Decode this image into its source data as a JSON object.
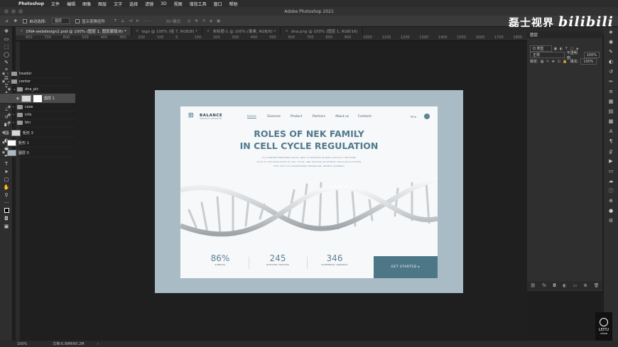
{
  "menubar": {
    "app": "Photoshop",
    "items": [
      "文件",
      "编辑",
      "图像",
      "图层",
      "文字",
      "选择",
      "滤镜",
      "3D",
      "视图",
      "增效工具",
      "窗口",
      "帮助"
    ]
  },
  "titlebar": {
    "title": "Adobe Photoshop 2021"
  },
  "options": {
    "auto_select_label": "自动选择:",
    "auto_select_value": "图层",
    "show_transform_label": "显示变换控件",
    "mode_label": "3D 模式:"
  },
  "brand": {
    "text": "磊士视界",
    "bili": "bilibili"
  },
  "tabs": [
    {
      "label": "DNA-webdesign2.psd @ 100% (图层 1, 图层蒙版/8) *"
    },
    {
      "label": "logo @ 100% (组 7, RGB/8) *"
    },
    {
      "label": "未标题-1 @ 100% (像素, RGB/8) *"
    },
    {
      "label": "dna.png @ 100% (图层 1, RGB/16)"
    }
  ],
  "ruler": {
    "ticks": [
      "800",
      "700",
      "600",
      "500",
      "400",
      "300",
      "200",
      "100",
      "0",
      "100",
      "200",
      "300",
      "400",
      "500",
      "600",
      "700",
      "800",
      "900",
      "1000",
      "1100",
      "1200",
      "1300",
      "1400",
      "1500",
      "1600",
      "1700",
      "1800"
    ]
  },
  "panel": {
    "title": "图层",
    "filter_label": "Q 类型",
    "blend_mode": "正常",
    "opacity_label": "不透明度:",
    "opacity_value": "100%",
    "lock_label": "锁定:",
    "fill_label": "填充:",
    "fill_value": "100%",
    "layers": [
      {
        "name": "header",
        "type": "folder"
      },
      {
        "name": "center",
        "type": "folder"
      },
      {
        "name": "dna_pic",
        "type": "folder"
      },
      {
        "name": "图层 1",
        "type": "layer",
        "selected": true
      },
      {
        "name": "case",
        "type": "folder"
      },
      {
        "name": "info",
        "type": "folder"
      },
      {
        "name": "btn",
        "type": "folder"
      },
      {
        "name": "矩形 3",
        "type": "layer"
      },
      {
        "name": "矩形 1",
        "type": "layer"
      },
      {
        "name": "图层 0",
        "type": "layer"
      }
    ]
  },
  "statusbar": {
    "zoom": "100%",
    "doc": "文档:6.99M/60.2M"
  },
  "leitu": {
    "label": "LEITU",
    "sub": "VISION"
  },
  "site": {
    "brand": "BALANCE",
    "brand_sub": "RESEARCH LABORATORY",
    "nav": [
      "Home",
      "Sciences",
      "Product",
      "Partners",
      "About us",
      "Contacts"
    ],
    "lang": "FR ▾",
    "headline_1": "ROLES OF NEK FAMILY",
    "headline_2": "IN CELL CYCLE REGULATION",
    "para_1": "AS A SERINE/THREONINE KINASE, NEK1 IS INVOLVED IN MANY CRITICAL FUNCTIONS",
    "para_2": "SUCH AS THE REGULATION OF CELL CYCLE, AND INVOLVES IN SEVERAL CELLULAR ACTIVITIES",
    "para_3": "THAT SUCH AS CHROMOSOME SEPARATION, SPINDLE ASSEMBLY",
    "stats": [
      {
        "num": "86%",
        "label": "SAMPLES"
      },
      {
        "num": "245",
        "label": "DISEASES TREATED"
      },
      {
        "num": "346",
        "label": "SCREENING LIBRARIES"
      }
    ],
    "cta": "GET STARTED ▸"
  }
}
